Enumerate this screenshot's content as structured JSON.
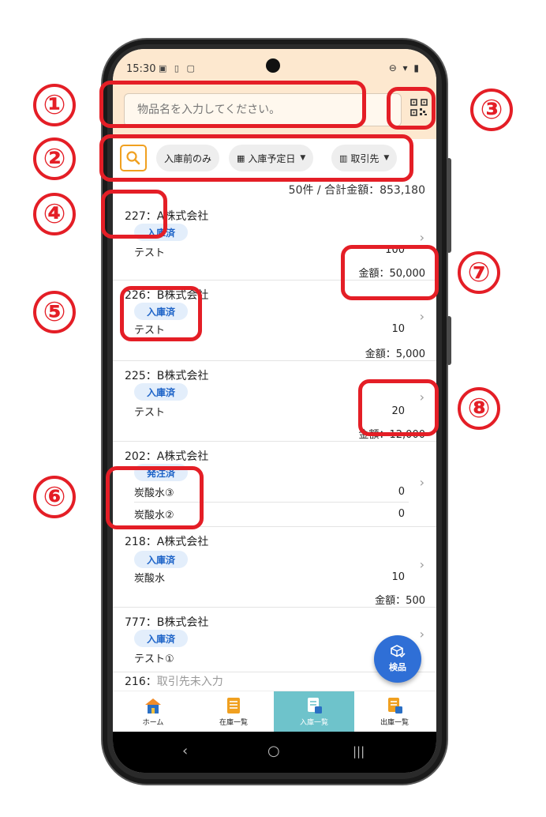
{
  "status_bar": {
    "time": "15:30",
    "left_icons": "▣ ▯ ▢",
    "right_icons": "⊖ ▾ ▮"
  },
  "search": {
    "placeholder": "物品名を入力してください。"
  },
  "filters": {
    "incoming_only": "入庫前のみ",
    "scheduled_date": "入庫予定日",
    "supplier": "取引先"
  },
  "summary": "50件 / 合計金額：853,180",
  "items": [
    {
      "title": "227：A株式会社",
      "status": "入庫済",
      "product": "テスト",
      "qty": "100",
      "amount": "金額：50,000"
    },
    {
      "title": "226：B株式会社",
      "status": "入庫済",
      "product": "テスト",
      "qty": "10",
      "amount": "金額：5,000"
    },
    {
      "title": "225：B株式会社",
      "status": "入庫済",
      "product": "テスト",
      "qty": "20",
      "amount": "金額：12,000"
    },
    {
      "title": "202：A株式会社",
      "status": "発注済",
      "product": "炭酸水③",
      "qty": "0",
      "product2": "炭酸水②",
      "qty2": "0"
    },
    {
      "title": "218：A株式会社",
      "status": "入庫済",
      "product": "炭酸水",
      "qty": "10",
      "amount": "金額：500"
    },
    {
      "title": "777：B株式会社",
      "status": "入庫済",
      "product": "テスト①"
    },
    {
      "title_prefix": "216：",
      "title_pending": "取引先未入力"
    }
  ],
  "fab": {
    "label": "検品"
  },
  "bottom_nav": [
    {
      "label": "ホーム",
      "color": "#f28c28"
    },
    {
      "label": "在庫一覧",
      "color": "#f0a020"
    },
    {
      "label": "入庫一覧",
      "color": "#ffffff"
    },
    {
      "label": "出庫一覧",
      "color": "#f0a020"
    }
  ],
  "annotations": [
    "①",
    "②",
    "③",
    "④",
    "⑤",
    "⑥",
    "⑦",
    "⑧"
  ],
  "colors": {
    "accent": "#e41e26",
    "status_bar_bg": "#fde8cf",
    "badge_text": "#1e64c8",
    "fab": "#2f6fd6",
    "nav_active": "#6ec3cb"
  }
}
